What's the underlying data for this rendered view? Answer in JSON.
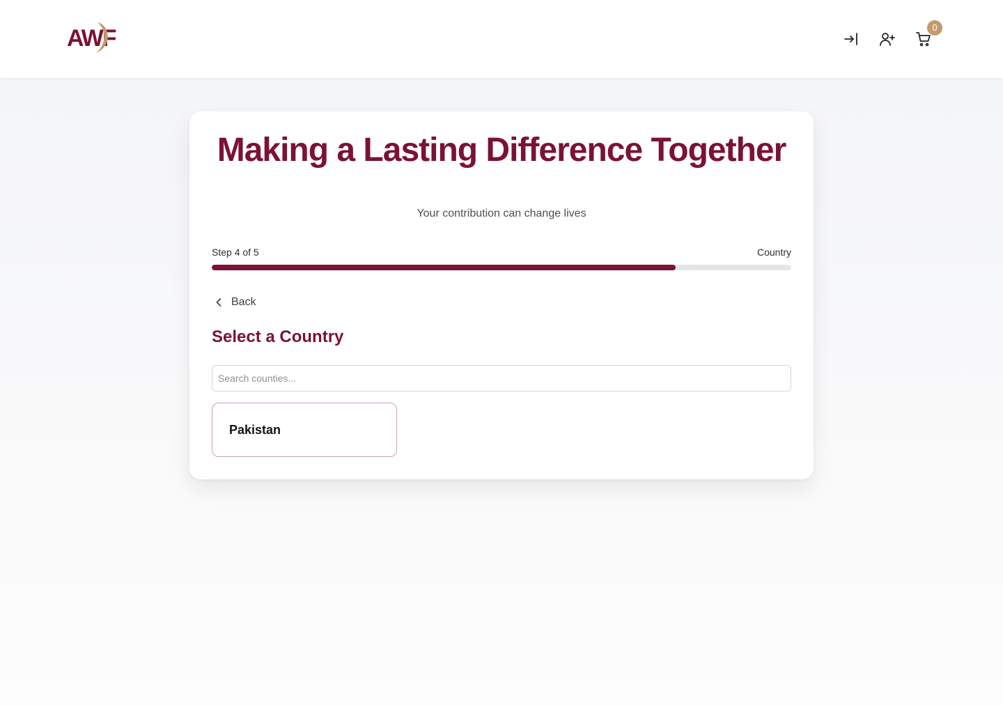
{
  "header": {
    "logo_text": "AWF",
    "cart_count": "0",
    "icons": [
      "login-icon",
      "user-plus-icon",
      "cart-icon"
    ]
  },
  "colors": {
    "brand": "#7b1234",
    "accent": "#c49a6c",
    "track": "#e6e6e8"
  },
  "hero": {
    "title": "Making a Lasting Difference Together",
    "subtitle": "Your contribution can change lives"
  },
  "progress": {
    "step_label": "Step 4 of 5",
    "step_name": "Country",
    "fraction": 0.8
  },
  "form": {
    "back_label": "Back",
    "heading": "Select a Country",
    "search_placeholder": "Search counties...",
    "countries": [
      {
        "name": "Pakistan"
      }
    ]
  }
}
